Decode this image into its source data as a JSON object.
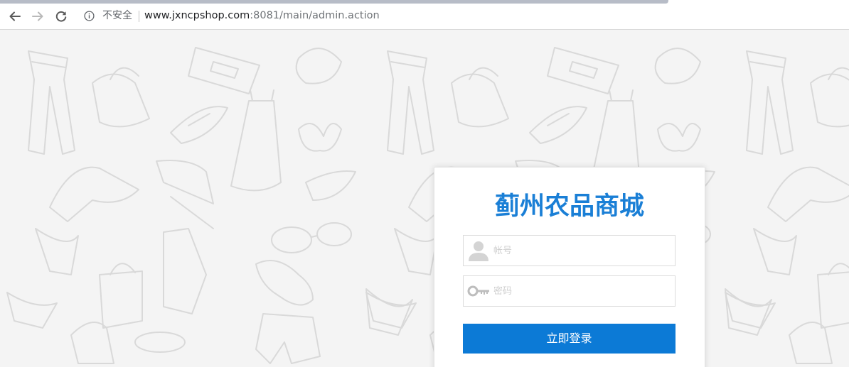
{
  "browser": {
    "security_label": "不安全",
    "url_host": "www.jxncpshop.com",
    "url_rest": ":8081/main/admin.action",
    "icons": {
      "back": "arrow-left-icon",
      "forward": "arrow-right-icon",
      "reload": "reload-icon",
      "info": "info-icon"
    }
  },
  "login": {
    "title": "蓟州农品商城",
    "username_placeholder": "帐号",
    "password_placeholder": "密码",
    "submit_label": "立即登录",
    "icons": {
      "username": "user-icon",
      "password": "key-icon"
    }
  },
  "colors": {
    "title": "#1a7fd6",
    "button": "#0c7ad6",
    "background": "#f4f4f4"
  }
}
